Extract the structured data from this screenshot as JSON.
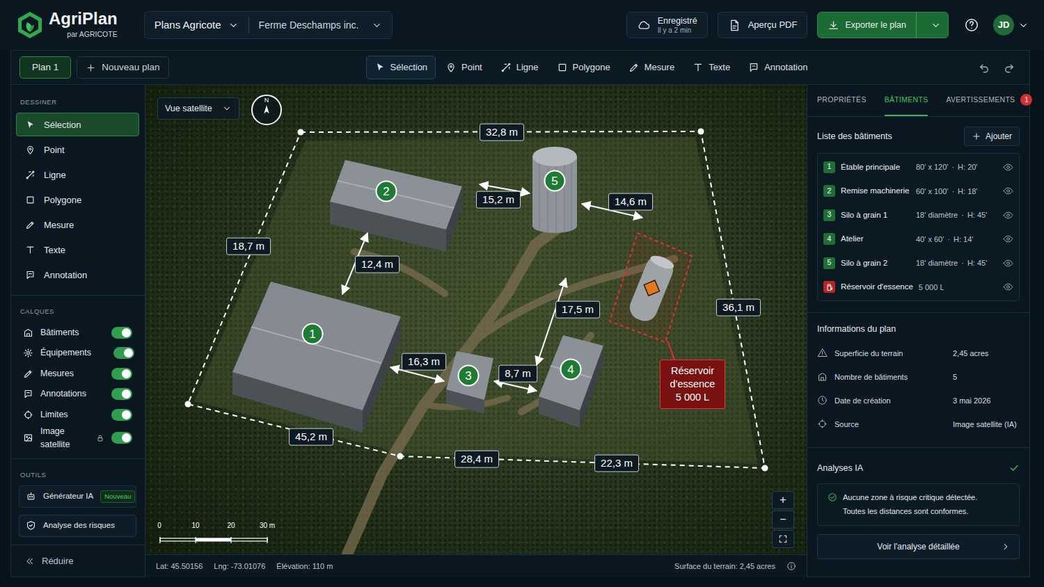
{
  "app": {
    "name": "AgriPlan",
    "byline": "par AGRICOTE"
  },
  "header": {
    "project_menu": "Plans Agricote",
    "farm_menu": "Ferme Deschamps inc.",
    "save_status": "Enregistré",
    "save_time": "Il y a 2 min",
    "pdf_button": "Aperçu PDF",
    "export_button": "Exporter le plan",
    "avatar": "JD"
  },
  "plan_tabs": [
    {
      "label": "Plan 1",
      "selected": true
    }
  ],
  "new_plan": "Nouveau plan",
  "toolbar": [
    {
      "label": "Sélection",
      "selected": true
    },
    {
      "label": "Point",
      "selected": false
    },
    {
      "label": "Ligne",
      "selected": false
    },
    {
      "label": "Polygone",
      "selected": false
    },
    {
      "label": "Mesure",
      "selected": false
    },
    {
      "label": "Texte",
      "selected": false
    },
    {
      "label": "Annotation",
      "selected": false
    }
  ],
  "sidebar": {
    "draw_title": "DESSINER",
    "draw_items": [
      {
        "label": "Sélection",
        "selected": true
      },
      {
        "label": "Point",
        "selected": false
      },
      {
        "label": "Ligne",
        "selected": false
      },
      {
        "label": "Polygone",
        "selected": false
      },
      {
        "label": "Mesure",
        "selected": false
      },
      {
        "label": "Texte",
        "selected": false
      },
      {
        "label": "Annotation",
        "selected": false
      }
    ],
    "layers_title": "CALQUES",
    "layers": [
      {
        "label": "Bâtiments",
        "on": true,
        "locked": false
      },
      {
        "label": "Équipements",
        "on": true,
        "locked": false
      },
      {
        "label": "Mesures",
        "on": true,
        "locked": false
      },
      {
        "label": "Annotations",
        "on": true,
        "locked": false
      },
      {
        "label": "Limites",
        "on": true,
        "locked": false
      },
      {
        "label": "Image satellite",
        "on": true,
        "locked": true
      }
    ],
    "tools_title": "OUTILS",
    "tools": [
      {
        "label": "Générateur IA",
        "badge": "Nouveau"
      },
      {
        "label": "Analyse des risques"
      }
    ],
    "collapse": "Réduire"
  },
  "map": {
    "view_menu": "Vue satellite",
    "compass": "N",
    "measurements": [
      "32,8 m",
      "18,7 m",
      "36,1 m",
      "45,2 m",
      "28,4 m",
      "22,3 m",
      "15,2 m",
      "14,6 m",
      "12,4 m",
      "17,5 m",
      "16,3 m",
      "8,7 m"
    ],
    "markers": [
      "1",
      "2",
      "3",
      "4",
      "5"
    ],
    "hazard": {
      "title": "Réservoir d'essence",
      "capacity": "5 000 L"
    },
    "scale": [
      "0",
      "10",
      "20",
      "30 m"
    ],
    "zoom_in": "+",
    "zoom_out": "−"
  },
  "status_bar": {
    "lat": "Lat: 45.50156",
    "lng": "Lng: -73.01076",
    "elevation": "Élévation: 110 m",
    "area": "Surface du terrain: 2,45 acres"
  },
  "right_panel": {
    "tabs": [
      {
        "label": "PROPRIÉTÉS",
        "selected": false
      },
      {
        "label": "BÂTIMENTS",
        "selected": true
      },
      {
        "label": "AVERTISSEMENTS",
        "selected": false,
        "badge": "1"
      }
    ],
    "list_title": "Liste des bâtiments",
    "add_button": "Ajouter",
    "detail_separator": "·",
    "buildings": [
      {
        "kind": "building",
        "number": "1",
        "name": "Étable principale",
        "details": [
          "80' x 120'",
          "H: 20'"
        ],
        "visible": true
      },
      {
        "kind": "building",
        "number": "2",
        "name": "Remise machinerie",
        "details": [
          "60' x 100'",
          "H: 18'"
        ],
        "visible": true
      },
      {
        "kind": "building",
        "number": "3",
        "name": "Silo à grain 1",
        "details": [
          "18' diamètre",
          "H: 45'"
        ],
        "visible": true
      },
      {
        "kind": "building",
        "number": "4",
        "name": "Atelier",
        "details": [
          "40' x 60'",
          "H: 14'"
        ],
        "visible": true
      },
      {
        "kind": "building",
        "number": "5",
        "name": "Silo à grain 2",
        "details": [
          "18' diamètre",
          "H: 45'"
        ],
        "visible": true
      },
      {
        "kind": "hazard",
        "name": "Réservoir d'essence",
        "details": [
          "5 000 L"
        ],
        "visible": true
      }
    ],
    "info_title": "Informations du plan",
    "info": [
      {
        "label": "Superficie du terrain",
        "value": "2,45 acres"
      },
      {
        "label": "Nombre de bâtiments",
        "value": "5"
      },
      {
        "label": "Date de création",
        "value": "3 mai 2026"
      },
      {
        "label": "Source",
        "value": "Image satellite (IA)"
      }
    ],
    "ai_title": "Analyses IA",
    "ai_ok": true,
    "ai_messages": [
      "Aucune zone à risque critique détectée.",
      "Toutes les distances sont conformes."
    ],
    "detail_button": "Voir l'analyse détaillée"
  }
}
